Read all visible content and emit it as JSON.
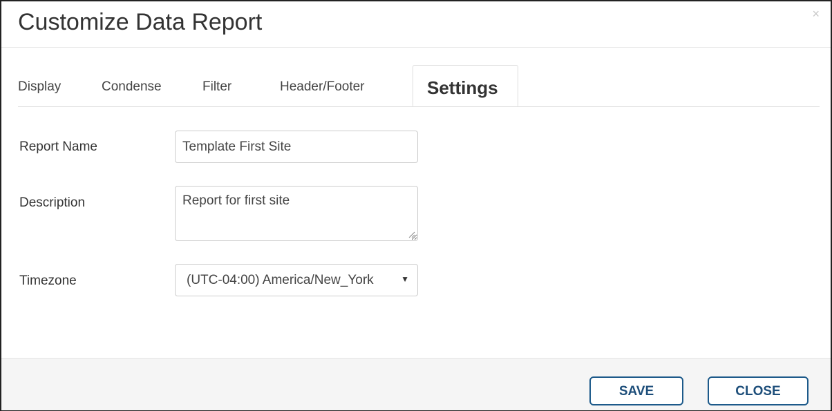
{
  "dialog": {
    "title": "Customize Data Report",
    "close_glyph": "×"
  },
  "tabs": [
    {
      "label": "Display",
      "active": false
    },
    {
      "label": "Condense",
      "active": false
    },
    {
      "label": "Filter",
      "active": false
    },
    {
      "label": "Header/Footer",
      "active": false
    },
    {
      "label": "Settings",
      "active": true
    }
  ],
  "form": {
    "report_name_label": "Report Name",
    "report_name_value": "Template First Site",
    "description_label": "Description",
    "description_value": "Report for first site",
    "timezone_label": "Timezone",
    "timezone_value": "(UTC-04:00) America/New_York",
    "timezone_arrow": "▼"
  },
  "footer": {
    "save_label": "SAVE",
    "close_label": "CLOSE"
  },
  "colors": {
    "button_border": "#1d5a8a",
    "button_text": "#1d4e7a",
    "footer_bg": "#f5f5f5"
  }
}
